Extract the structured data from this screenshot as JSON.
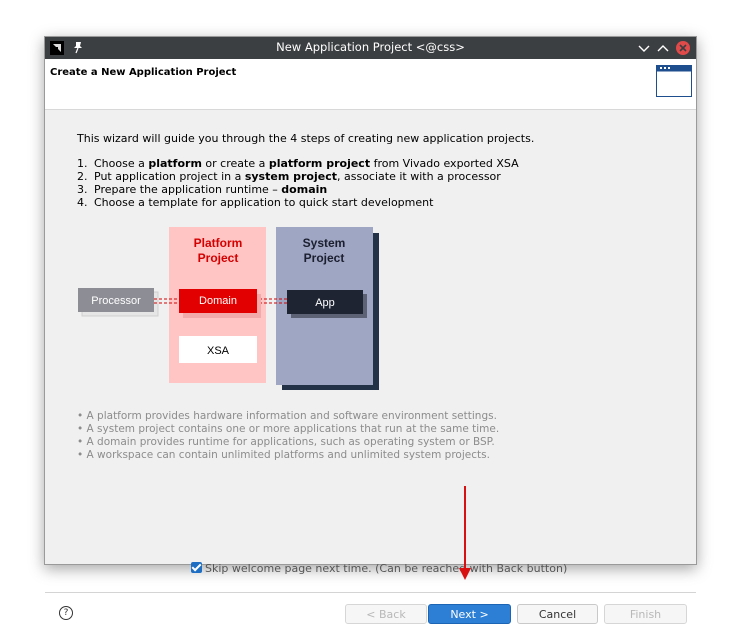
{
  "window": {
    "title": "New Application Project <@css>"
  },
  "header": {
    "heading": "Create a New Application Project"
  },
  "intro": "This wizard will guide you through the 4 steps of creating new application projects.",
  "steps": [
    {
      "num": "1.",
      "parts": [
        "Choose a ",
        "platform",
        " or create a ",
        "platform project",
        " from Vivado exported XSA"
      ]
    },
    {
      "num": "2.",
      "parts": [
        "Put application project in a ",
        "system project",
        ", associate it with a processor"
      ]
    },
    {
      "num": "3.",
      "parts": [
        "Prepare the application runtime – ",
        "domain",
        ""
      ]
    },
    {
      "num": "4.",
      "parts": [
        "Choose a template for application to quick start development"
      ]
    }
  ],
  "diagram": {
    "platform_title_1": "Platform",
    "platform_title_2": "Project",
    "system_title_1": "System",
    "system_title_2": "Project",
    "processor": "Processor",
    "domain": "Domain",
    "app": "App",
    "xsa": "XSA",
    "colors": {
      "platform_bg": "#ffc4c4",
      "platform_title": "#d40000",
      "domain": "#e30000",
      "system_bg": "#9fa6c4",
      "system_shadow": "#233247",
      "app": "#1e2432",
      "processor": "#8d8d95"
    }
  },
  "bullets": [
    "• A platform provides hardware information and software environment settings.",
    "• A system project contains one or more applications that run at the same time.",
    "• A domain provides runtime for applications, such as operating system or BSP.",
    "• A workspace can contain unlimited platforms and unlimited system projects."
  ],
  "skip_label": "Skip welcome page next time. (Can be reached with Back button)",
  "skip_checked": true,
  "buttons": {
    "help": "?",
    "back": "< Back",
    "next": "Next >",
    "cancel": "Cancel",
    "finish": "Finish"
  },
  "icons": [
    "amd-logo-icon",
    "pin-icon",
    "minimize-icon",
    "maximize-icon",
    "close-icon",
    "wizard-window-icon",
    "help-icon",
    "checkbox-checked-icon"
  ]
}
